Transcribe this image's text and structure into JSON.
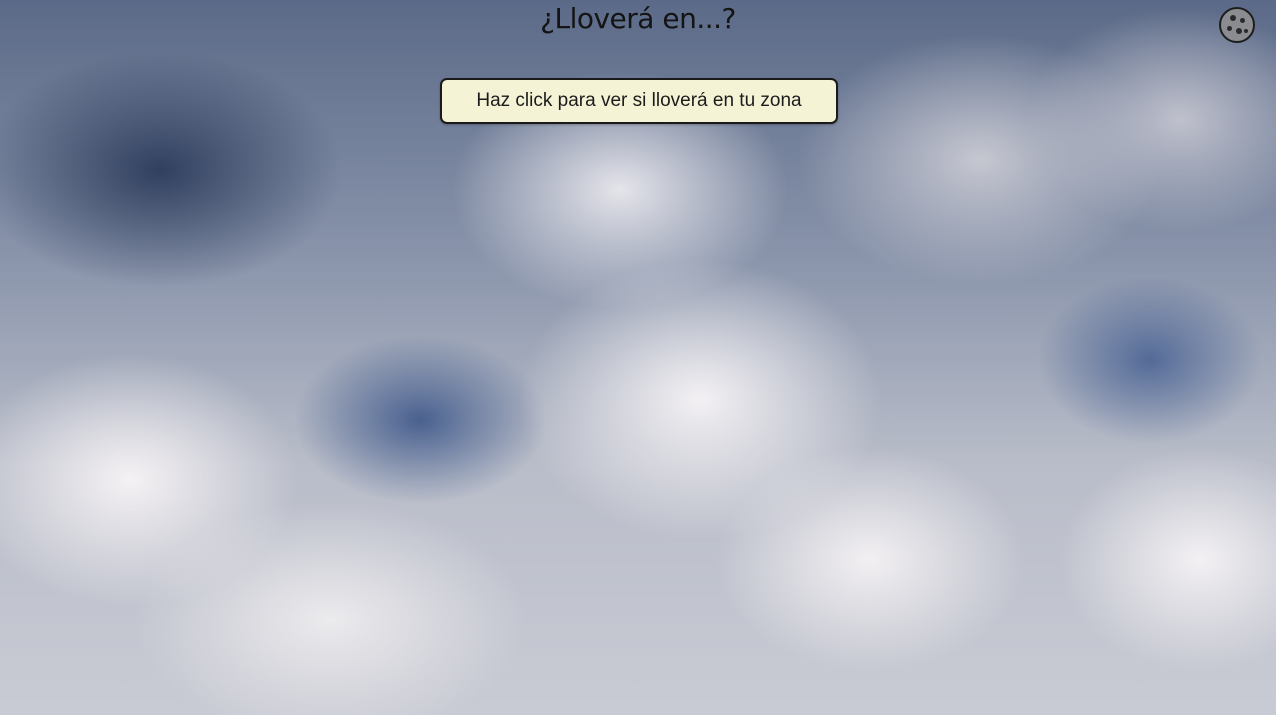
{
  "page": {
    "title": "¿Lloverá en...?"
  },
  "main": {
    "check_button_label": "Haz click para ver si lloverá en tu zona"
  },
  "header": {
    "cookie_icon": "cookie-icon"
  },
  "colors": {
    "button_background": "#f5f3d6",
    "button_border": "#1a1a1a",
    "title_text": "#141414"
  }
}
